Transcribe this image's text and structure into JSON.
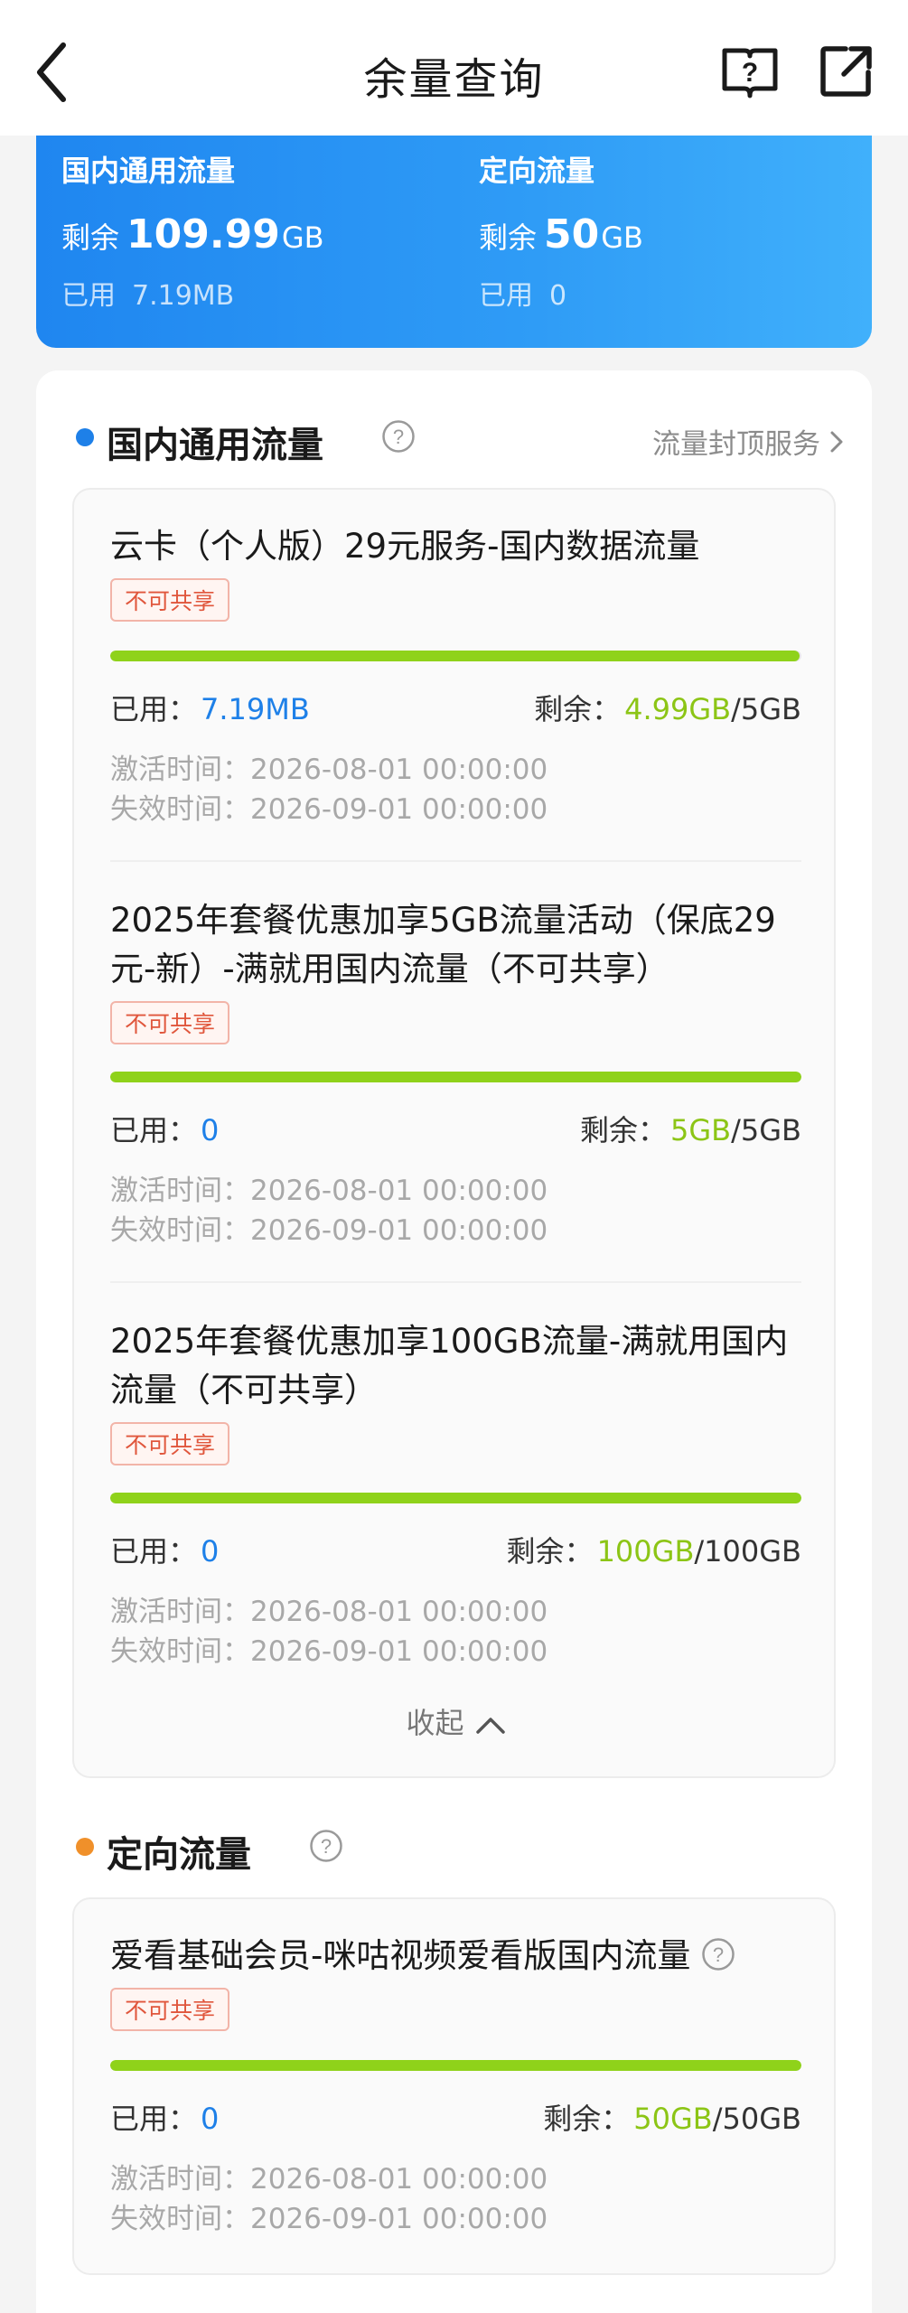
{
  "header": {
    "title": "余量查询"
  },
  "summary": {
    "domestic": {
      "title": "国内通用流量",
      "remain_label": "剩余",
      "remain_value": "109.99",
      "remain_unit": "GB",
      "used_label": "已用",
      "used_value": "7.19MB"
    },
    "targeted": {
      "title": "定向流量",
      "remain_label": "剩余",
      "remain_value": "50",
      "remain_unit": "GB",
      "used_label": "已用",
      "used_value": "0"
    }
  },
  "sections": {
    "domestic": {
      "title": "国内通用流量",
      "cap_link": "流量封顶服务",
      "collapse_label": "收起",
      "items": [
        {
          "title": "云卡（个人版）29元服务-国内数据流量",
          "tag": "不可共享",
          "used_label": "已用：",
          "used_value": "7.19MB",
          "remain_label": "剩余：",
          "remain_value": "4.99GB",
          "total": "/5GB",
          "remaining_fraction": 0.998,
          "activate": "激活时间：2026-08-01 00:00:00",
          "expire": "失效时间：2026-09-01 00:00:00"
        },
        {
          "title": "2025年套餐优惠加享5GB流量活动（保底29元-新）-满就用国内流量（不可共享）",
          "tag": "不可共享",
          "used_label": "已用：",
          "used_value": "0",
          "remain_label": "剩余：",
          "remain_value": "5GB",
          "total": "/5GB",
          "remaining_fraction": 1.0,
          "activate": "激活时间：2026-08-01 00:00:00",
          "expire": "失效时间：2026-09-01 00:00:00"
        },
        {
          "title": "2025年套餐优惠加享100GB流量-满就用国内流量（不可共享）",
          "tag": "不可共享",
          "used_label": "已用：",
          "used_value": "0",
          "remain_label": "剩余：",
          "remain_value": "100GB",
          "total": "/100GB",
          "remaining_fraction": 1.0,
          "activate": "激活时间：2026-08-01 00:00:00",
          "expire": "失效时间：2026-09-01 00:00:00"
        }
      ]
    },
    "targeted": {
      "title": "定向流量",
      "items": [
        {
          "title": "爱看基础会员-咪咕视频爱看版国内流量",
          "tag": "不可共享",
          "used_label": "已用：",
          "used_value": "0",
          "remain_label": "剩余：",
          "remain_value": "50GB",
          "total": "/50GB",
          "remaining_fraction": 1.0,
          "activate": "激活时间：2026-08-01 00:00:00",
          "expire": "失效时间：2026-09-01 00:00:00"
        }
      ]
    }
  },
  "colors": {
    "brand_blue": "#1f86f0",
    "progress_green": "#8fd21a",
    "domestic_dot": "#1e80e8",
    "targeted_dot": "#f0902a",
    "tag_red": "#e0563c"
  }
}
